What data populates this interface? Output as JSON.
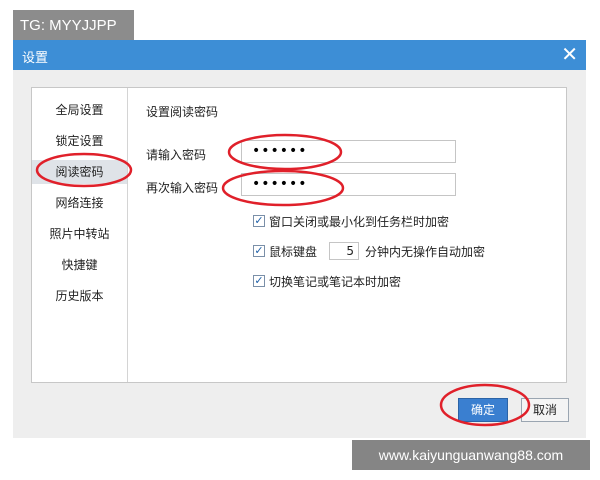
{
  "tag": "TG: MYYJJPP",
  "dialog": {
    "title": "设置"
  },
  "nav": {
    "items": [
      {
        "label": "全局设置"
      },
      {
        "label": "锁定设置"
      },
      {
        "label": "阅读密码"
      },
      {
        "label": "网络连接"
      },
      {
        "label": "照片中转站"
      },
      {
        "label": "快捷键"
      },
      {
        "label": "历史版本"
      }
    ],
    "active": "阅读密码"
  },
  "main": {
    "section_title": "设置阅读密码",
    "password_label": "请输入密码",
    "password_value": "••••••",
    "confirm_label": "再次输入密码",
    "confirm_value": "••••••",
    "options": {
      "minimize": {
        "label": "窗口关闭或最小化到任务栏时加密",
        "checked": true
      },
      "idle": {
        "label_before": "鼠标键盘",
        "minutes": "5",
        "label_after": "分钟内无操作自动加密",
        "checked": true
      },
      "switch": {
        "label": "切换笔记或笔记本时加密",
        "checked": true
      }
    }
  },
  "buttons": {
    "ok": "确定",
    "cancel": "取消"
  },
  "watermark": "www.kaiyunguanwang88.com",
  "colors": {
    "titlebar": "#3d8ed6",
    "annotation": "#e0202a",
    "nav_active": "#dfe3e8"
  }
}
